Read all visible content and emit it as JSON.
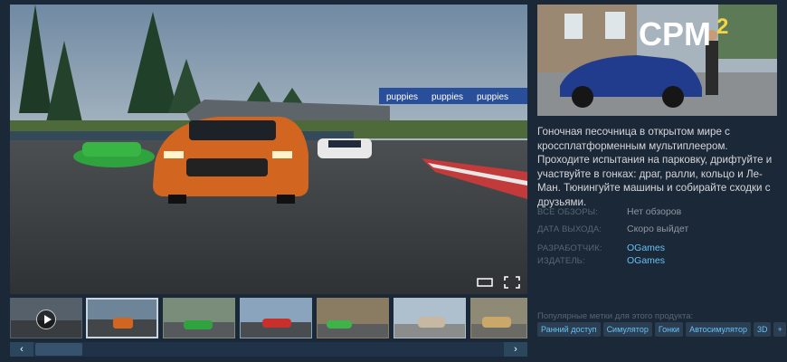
{
  "capsule": {
    "logo_text": "CPM",
    "logo_sup": "2"
  },
  "description": "Гоночная песочница в открытом мире с кроссплатформенным мультиплеером. Проходите испытания на парковку, дрифтуйте и участвуйте в гонках: драг, ралли, кольцо и Ле-Ман. Тюнингуйте машины и собирайте сходки с друзьями.",
  "meta": {
    "reviews_label": "ВСЕ ОБЗОРЫ:",
    "reviews_value": "Нет обзоров",
    "release_label": "ДАТА ВЫХОДА:",
    "release_value": "Скоро выйдет",
    "developer_label": "РАЗРАБОТЧИК:",
    "developer_value": "OGames",
    "publisher_label": "ИЗДАТЕЛЬ:",
    "publisher_value": "OGames"
  },
  "tags_label": "Популярные метки для этого продукта:",
  "tags": [
    "Ранний доступ",
    "Симулятор",
    "Гонки",
    "Автосимулятор",
    "3D",
    "+"
  ],
  "banner": {
    "text": "puppies"
  },
  "scroll": {
    "left": "‹",
    "right": "›"
  },
  "colors": {
    "bg": "#1b2838",
    "link": "#66c0f4",
    "tag_bg": "#2b3e52"
  }
}
